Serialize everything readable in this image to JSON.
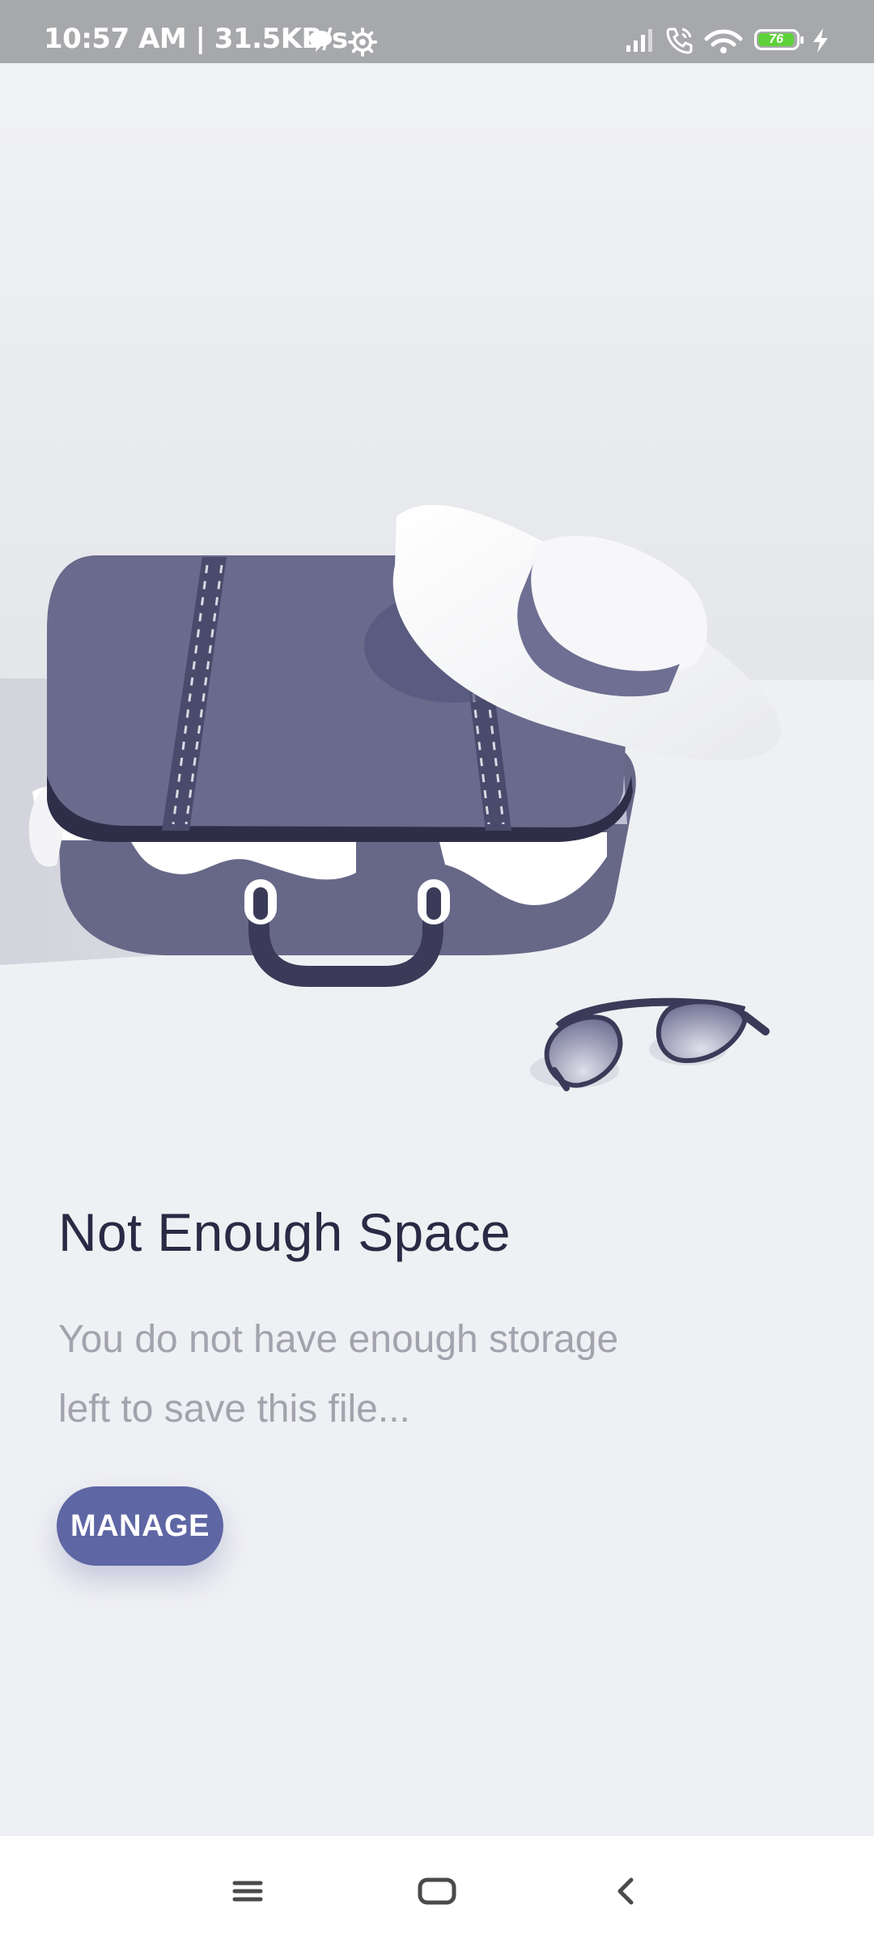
{
  "status_bar": {
    "time": "10:57 AM | 31.5KB/s",
    "battery_level": "76",
    "icons": [
      "chat-bubble-icon",
      "gear-icon",
      "signal-icon",
      "wifi-calling-icon",
      "wifi-icon",
      "battery-icon",
      "charging-bolt-icon"
    ]
  },
  "illustration": {
    "subject": "suitcase-with-hat-and-sunglasses"
  },
  "main": {
    "title": "Not Enough Space",
    "message_line1": "You do not have enough storage",
    "message_line2": "left to save this file...",
    "manage_button_label": "MANAGE"
  },
  "nav_bar": {
    "icons": [
      "recents-menu-icon",
      "home-icon",
      "back-icon"
    ]
  },
  "colors": {
    "accent": "#5f66a4",
    "title": "#2b2a45",
    "body_text": "#a3a3ad",
    "background": "#eff0f3",
    "status_bar": "#a7a8ab",
    "suitcase": "#676888",
    "battery": "#5fd13a"
  }
}
